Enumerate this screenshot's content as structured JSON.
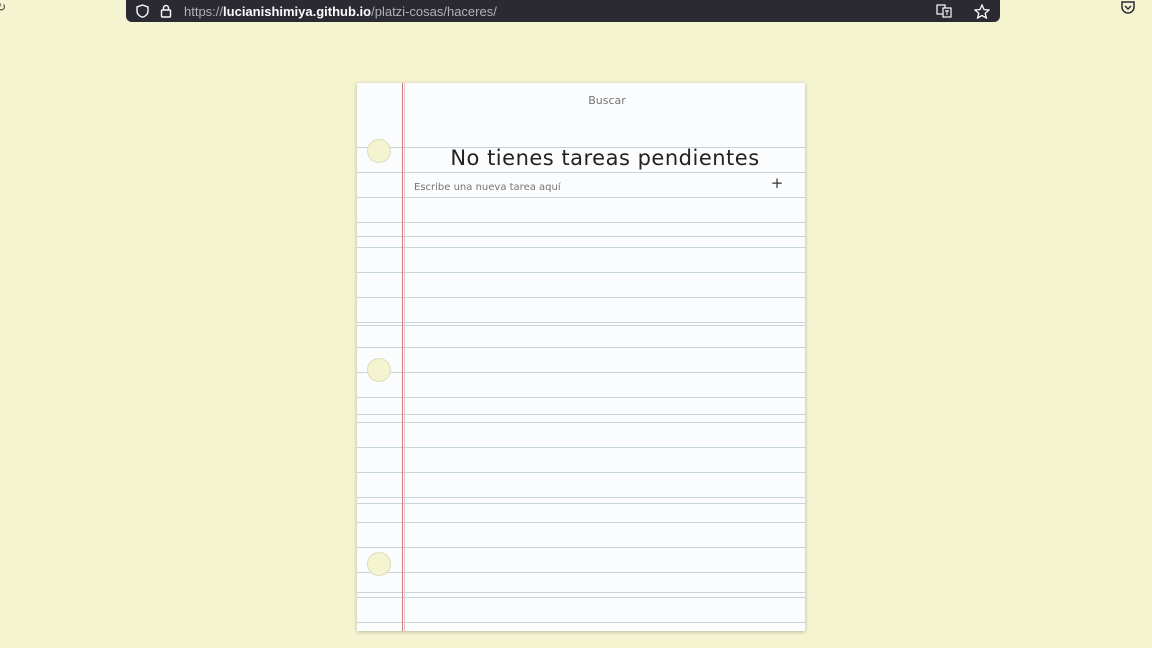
{
  "browser": {
    "url_prefix": "https://",
    "url_host": "lucianishimiya.github.io",
    "url_path": "/platzi-cosas/haceres/",
    "icons": [
      "shield-icon",
      "lock-icon",
      "translate-icon",
      "star-icon",
      "pocket-icon"
    ]
  },
  "app": {
    "search_placeholder": "Buscar",
    "empty_title": "No tienes tareas pendientes",
    "new_task_placeholder": "Escribe una nueva tarea aquí",
    "add_label": "+"
  },
  "colors": {
    "background": "#f5f4d0",
    "paper": "#fbfcfd",
    "rule_line": "#c8d4dc",
    "margin_line": "#c77f7f"
  }
}
